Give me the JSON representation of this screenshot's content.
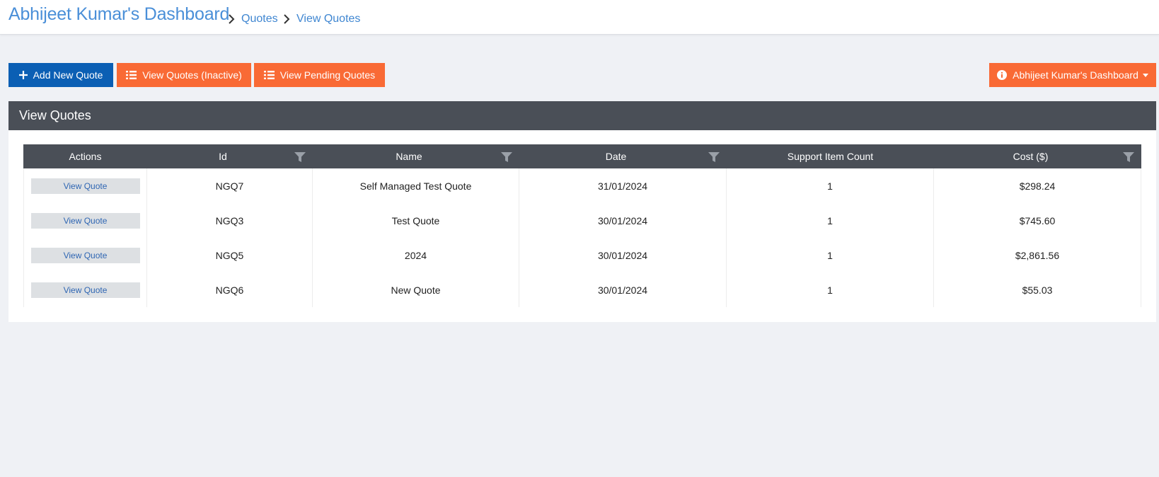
{
  "header": {
    "app_title": "Abhijeet Kumar's Dashboard",
    "breadcrumb": [
      {
        "label": "Quotes"
      },
      {
        "label": "View Quotes"
      }
    ]
  },
  "toolbar": {
    "add_label": "Add New Quote",
    "inactive_label": "View Quotes (Inactive)",
    "pending_label": "View Pending Quotes",
    "dashboard_dropdown_label": "Abhijeet Kumar's Dashboard",
    "colors": {
      "primary": "#0b5fb4",
      "accent": "#f96a35"
    }
  },
  "panel": {
    "title": "View Quotes"
  },
  "table": {
    "columns": [
      "Actions",
      "Id",
      "Name",
      "Date",
      "Support Item Count",
      "Cost ($)"
    ],
    "rows": [
      {
        "action": "View Quote",
        "id": "NGQ7",
        "name": "Self Managed Test Quote",
        "date": "31/01/2024",
        "count": "1",
        "cost": "$298.24"
      },
      {
        "action": "View Quote",
        "id": "NGQ3",
        "name": "Test Quote",
        "date": "30/01/2024",
        "count": "1",
        "cost": "$745.60"
      },
      {
        "action": "View Quote",
        "id": "NGQ5",
        "name": "2024",
        "date": "30/01/2024",
        "count": "1",
        "cost": "$2,861.56"
      },
      {
        "action": "View Quote",
        "id": "NGQ6",
        "name": "New Quote",
        "date": "30/01/2024",
        "count": "1",
        "cost": "$55.03"
      }
    ]
  }
}
